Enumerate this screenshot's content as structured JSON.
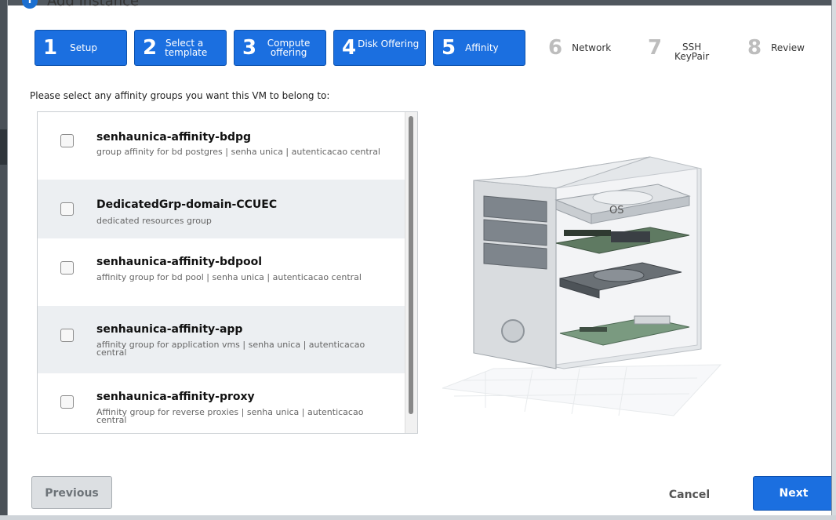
{
  "dialog": {
    "title": "Add Instance",
    "title_icon": "info-icon"
  },
  "steps": [
    {
      "num": "1",
      "label": "Setup",
      "state": "active"
    },
    {
      "num": "2",
      "label": "Select a template",
      "state": "active"
    },
    {
      "num": "3",
      "label": "Compute offering",
      "state": "active"
    },
    {
      "num": "4",
      "label": "Disk Offering",
      "state": "active"
    },
    {
      "num": "5",
      "label": "Affinity",
      "state": "active"
    },
    {
      "num": "6",
      "label": "Network",
      "state": "inactive"
    },
    {
      "num": "7",
      "label": "SSH KeyPair",
      "state": "inactive"
    },
    {
      "num": "8",
      "label": "Review",
      "state": "inactive"
    }
  ],
  "instruction": "Please select any affinity groups you want this VM to belong to:",
  "affinity_groups": [
    {
      "name": "senhaunica-affinity-bdpg",
      "description": "group affinity for bd postgres | senha unica | autenticacao central",
      "checked": false
    },
    {
      "name": "DedicatedGrp-domain-CCUEC",
      "description": "dedicated resources group",
      "checked": false
    },
    {
      "name": "senhaunica-affinity-bdpool",
      "description": "affinity group for bd pool | senha unica | autenticacao central",
      "checked": false
    },
    {
      "name": "senhaunica-affinity-app",
      "description": "affinity group for application vms | senha unica | autenticacao central",
      "checked": false
    },
    {
      "name": "senhaunica-affinity-proxy",
      "description": "Affinity group for reverse proxies | senha unica | autenticacao central",
      "checked": false
    }
  ],
  "illustration": {
    "os_label": "OS"
  },
  "footer": {
    "previous": "Previous",
    "cancel": "Cancel",
    "next": "Next"
  },
  "colors": {
    "accent": "#1b6fe0",
    "alt_row": "#eceff2"
  }
}
